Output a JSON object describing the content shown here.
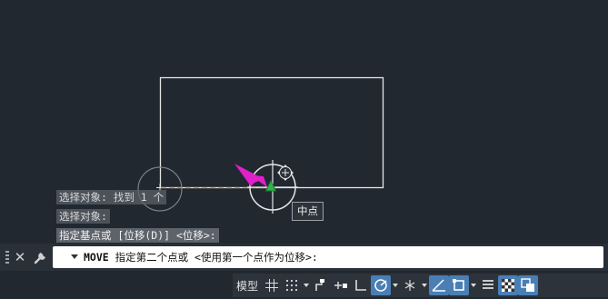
{
  "command_history": [
    "选择对象: 找到 1 个",
    "选择对象:",
    "指定基点或 [位移(D)] <位移>:"
  ],
  "tooltip": "中点",
  "command_line": {
    "command": "MOVE",
    "prompt": " 指定第二个点或 <使用第一个点作为位移>:"
  },
  "status_bar": {
    "model_tab": "模型"
  },
  "colors": {
    "background": "#212830",
    "geometry": "#e6e6e6",
    "snap_marker": "#2db34a",
    "arrow": "#e020c8",
    "rubber_band": "#e0a030",
    "status_active": "#4a7fb5"
  }
}
